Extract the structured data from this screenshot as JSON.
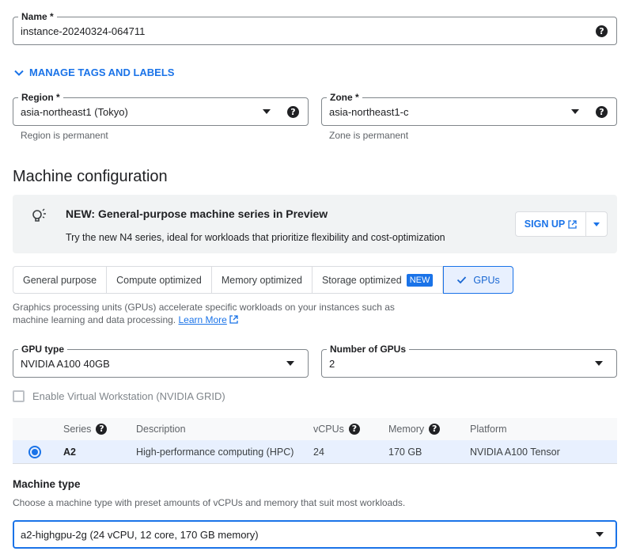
{
  "name_field": {
    "label": "Name *",
    "value": "instance-20240324-064711"
  },
  "manage_tags": {
    "label": "MANAGE TAGS AND LABELS"
  },
  "region": {
    "label": "Region *",
    "value": "asia-northeast1 (Tokyo)",
    "hint": "Region is permanent"
  },
  "zone": {
    "label": "Zone *",
    "value": "asia-northeast1-c",
    "hint": "Zone is permanent"
  },
  "help_glyph": "?",
  "machine_config": {
    "title": "Machine configuration"
  },
  "banner": {
    "title": "NEW: General-purpose machine series in Preview",
    "text": "Try the new N4 series, ideal for workloads that prioritize flexibility and cost-optimization",
    "button": "SIGN UP"
  },
  "tabs": [
    {
      "label": "General purpose"
    },
    {
      "label": "Compute optimized"
    },
    {
      "label": "Memory optimized"
    },
    {
      "label": "Storage optimized",
      "badge": "NEW"
    },
    {
      "label": "GPUs",
      "selected": true
    }
  ],
  "gpu_description": {
    "text": "Graphics processing units (GPUs) accelerate specific workloads on your instances such as machine learning and data processing.",
    "link": "Learn More"
  },
  "gpu_type": {
    "label": "GPU type",
    "value": "NVIDIA A100 40GB"
  },
  "gpu_count": {
    "label": "Number of GPUs",
    "value": "2"
  },
  "virtual_workstation": {
    "label": "Enable Virtual Workstation (NVIDIA GRID)",
    "checked": false
  },
  "series_table": {
    "headers": [
      "Series",
      "Description",
      "vCPUs",
      "Memory",
      "Platform"
    ],
    "rows": [
      {
        "series": "A2",
        "description": "High-performance computing (HPC)",
        "vcpus": "24",
        "memory": "170 GB",
        "platform": "NVIDIA A100 Tensor",
        "selected": true
      }
    ]
  },
  "machine_type": {
    "label": "Machine type",
    "description": "Choose a machine type with preset amounts of vCPUs and memory that suit most workloads.",
    "value": "a2-highgpu-2g (24 vCPU, 12 core, 170 GB memory)"
  },
  "colors": {
    "accent": "#1a73e8",
    "selected_bg": "#e8f0fe",
    "banner_bg": "#f1f3f4"
  }
}
